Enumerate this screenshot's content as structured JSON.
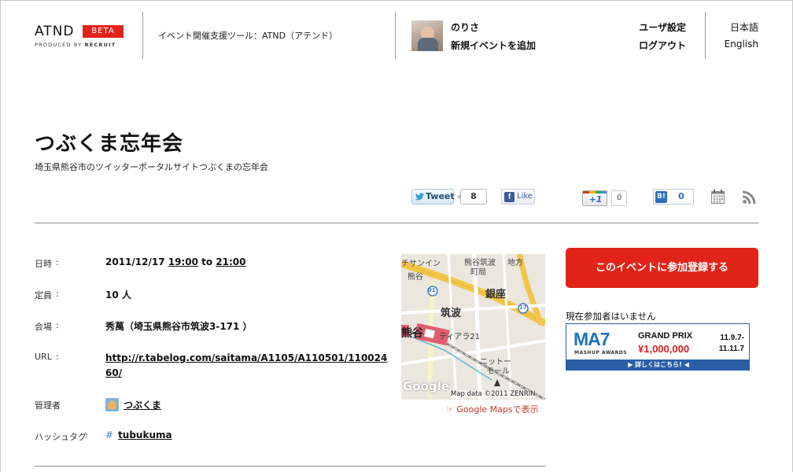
{
  "header": {
    "logo_text": "ATND",
    "logo_badge": "BETA",
    "logo_sub_prefix": "PRODUCED BY",
    "logo_sub_brand": "RECRUIT",
    "tagline": "イベント開催支援ツール：ATND（アテンド）",
    "user_name": "のりさ",
    "add_event": "新規イベントを追加",
    "user_settings": "ユーザ設定",
    "logout": "ログアウト",
    "lang_ja": "日本語",
    "lang_en": "English"
  },
  "event": {
    "title": "つぶくま忘年会",
    "subtitle": "埼玉県熊谷市のツイッターポータルサイトつぶくまの忘年会"
  },
  "social": {
    "tweet_label": "Tweet",
    "tweet_count": "8",
    "like_label": "Like",
    "plus_label": "+1",
    "plus_count": "0",
    "hatena_label": "B!",
    "hatena_count": "0",
    "calendar_icon": "calendar-icon",
    "rss_icon": "rss-icon"
  },
  "details": {
    "colon": ":",
    "datetime_label": "日時",
    "date": "2011/12/17",
    "start_time": "19:00",
    "to": "to",
    "end_time": "21:00",
    "capacity_label": "定員",
    "capacity": "10 人",
    "venue_label": "会場",
    "venue": "秀萬（埼玉県熊谷市筑波3-171 ）",
    "url_label": "URL",
    "url": "http://r.tabelog.com/saitama/A1105/A110501/11002460/",
    "owner_label": "管理者",
    "owner": "つぶくま",
    "hashtag_label": "ハッシュタグ",
    "hash_mark": "#",
    "hashtag": "tubukuma"
  },
  "map": {
    "labels": {
      "sunshine": "チサンイン",
      "kumagaya_tsukuba": "熊谷筑波",
      "machikyoku": "町局",
      "chihou": "地方",
      "station": "熊谷",
      "ginza": "銀座",
      "tsukuba": "筑波",
      "tiara": "ティアラ21",
      "nitto_1": "ニットー",
      "nitto_2": "モール",
      "route_91": "91",
      "route_17": "17",
      "google": "Google",
      "attribution": "Map data ©2011 ZENRIN"
    },
    "link_text": "☞ Google Mapsで表示"
  },
  "sidebar": {
    "register_button": "このイベントに参加登録する",
    "no_participants": "現在参加者はいません",
    "banner": {
      "logo_ma": "MA",
      "logo_7": "7",
      "mashup": "MASHUP AWARDS",
      "grand_prix": "GRAND PRIX",
      "prize": "¥1,000,000",
      "date_start": "11.9.7-",
      "date_end": "11.11.7",
      "more": "▶ 詳しくはこちら! ◀"
    }
  }
}
